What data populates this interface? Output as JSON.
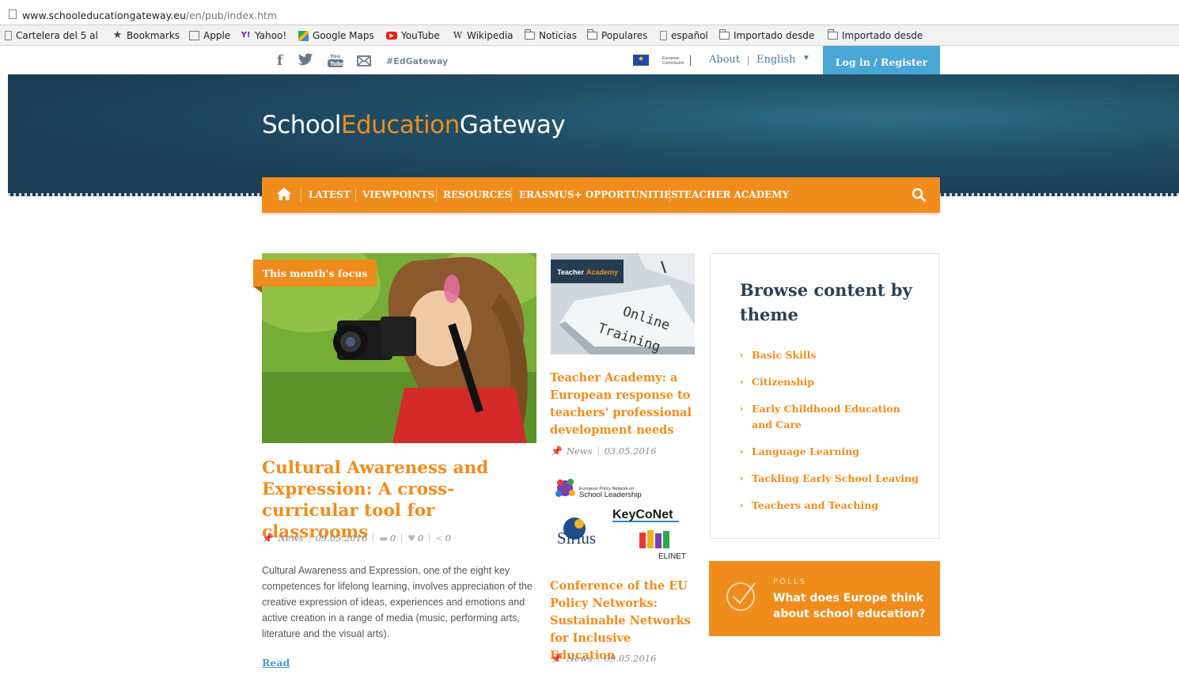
{
  "browser": {
    "url_host": "www.schooleducationgateway.eu",
    "url_path": "/en/pub/index.htm",
    "bookmarks": [
      {
        "label": "Cartelera del 5 al",
        "icon": "page-icon"
      },
      {
        "label": "Bookmarks",
        "icon": "star-icon"
      },
      {
        "label": "Apple",
        "icon": "apple-page-icon"
      },
      {
        "label": "Yahoo!",
        "icon": "yahoo-icon"
      },
      {
        "label": "Google Maps",
        "icon": "google-maps-icon"
      },
      {
        "label": "YouTube",
        "icon": "youtube-icon"
      },
      {
        "label": "Wikipedia",
        "icon": "wikipedia-icon"
      },
      {
        "label": "Noticias",
        "icon": "folder-icon"
      },
      {
        "label": "Populares",
        "icon": "folder-icon"
      },
      {
        "label": "español",
        "icon": "page-icon"
      },
      {
        "label": "Importado desde",
        "icon": "folder-icon"
      },
      {
        "label": "Importado desde",
        "icon": "folder-icon"
      }
    ]
  },
  "topbar": {
    "hashtag": "#EdGateway",
    "ec_label": "European Commission",
    "about": "About",
    "separator": "|",
    "language": "English",
    "login": "Log in / Register"
  },
  "logo": {
    "part1": "School",
    "part2": "Education",
    "part3": "Gateway"
  },
  "nav": {
    "items": [
      "LATEST",
      "VIEWPOINTS",
      "RESOURCES",
      "ERASMUS+ OPPORTUNITIES",
      "TEACHER ACADEMY"
    ]
  },
  "featured": {
    "badge": "This month's focus",
    "title": "Cultural Awareness and Expression: A cross-curricular tool for classrooms",
    "category": "News",
    "date": "09.05.2016",
    "comments": "0",
    "likes": "0",
    "shares": "0",
    "description": "Cultural Awareness and Expression, one of the eight key competences for lifelong learning, involves appreciation of the creative expression of ideas, experiences and emotions and active creation in a range of media (music, performing arts, literature and the visual arts).",
    "read": "Read"
  },
  "middle": {
    "ta_badge_part1": "Teacher",
    "ta_badge_part2": "Academy",
    "ta_key_line1": "Online",
    "ta_key_line2": "Training",
    "article1_title": "Teacher Academy: a European response to teachers' professional development needs",
    "article1_category": "News",
    "article1_date": "03.05.2016",
    "logos": {
      "epnosl_line1": "European Policy Network on",
      "epnosl_line2": "School Leadership",
      "keyconet": "KeyCoNet",
      "sirius": "Sirius",
      "elinet": "ELINET"
    },
    "article2_title": "Conference of the EU Policy Networks: Sustainable Networks for Inclusive Education",
    "article2_category": "News",
    "article2_date": "09.05.2016"
  },
  "browse": {
    "title": "Browse content by theme",
    "themes": [
      "Basic Skills",
      "Citizenship",
      "Early Childhood Education and Care",
      "Language Learning",
      "Tackling Early School Leaving",
      "Teachers and Teaching"
    ]
  },
  "polls": {
    "label": "POLLS",
    "question": "What does Europe think about school education?"
  },
  "colors": {
    "orange": "#f08c1c",
    "navy": "#1f4e66",
    "login_blue": "#4aa6d6",
    "title_dark": "#2d4256"
  }
}
